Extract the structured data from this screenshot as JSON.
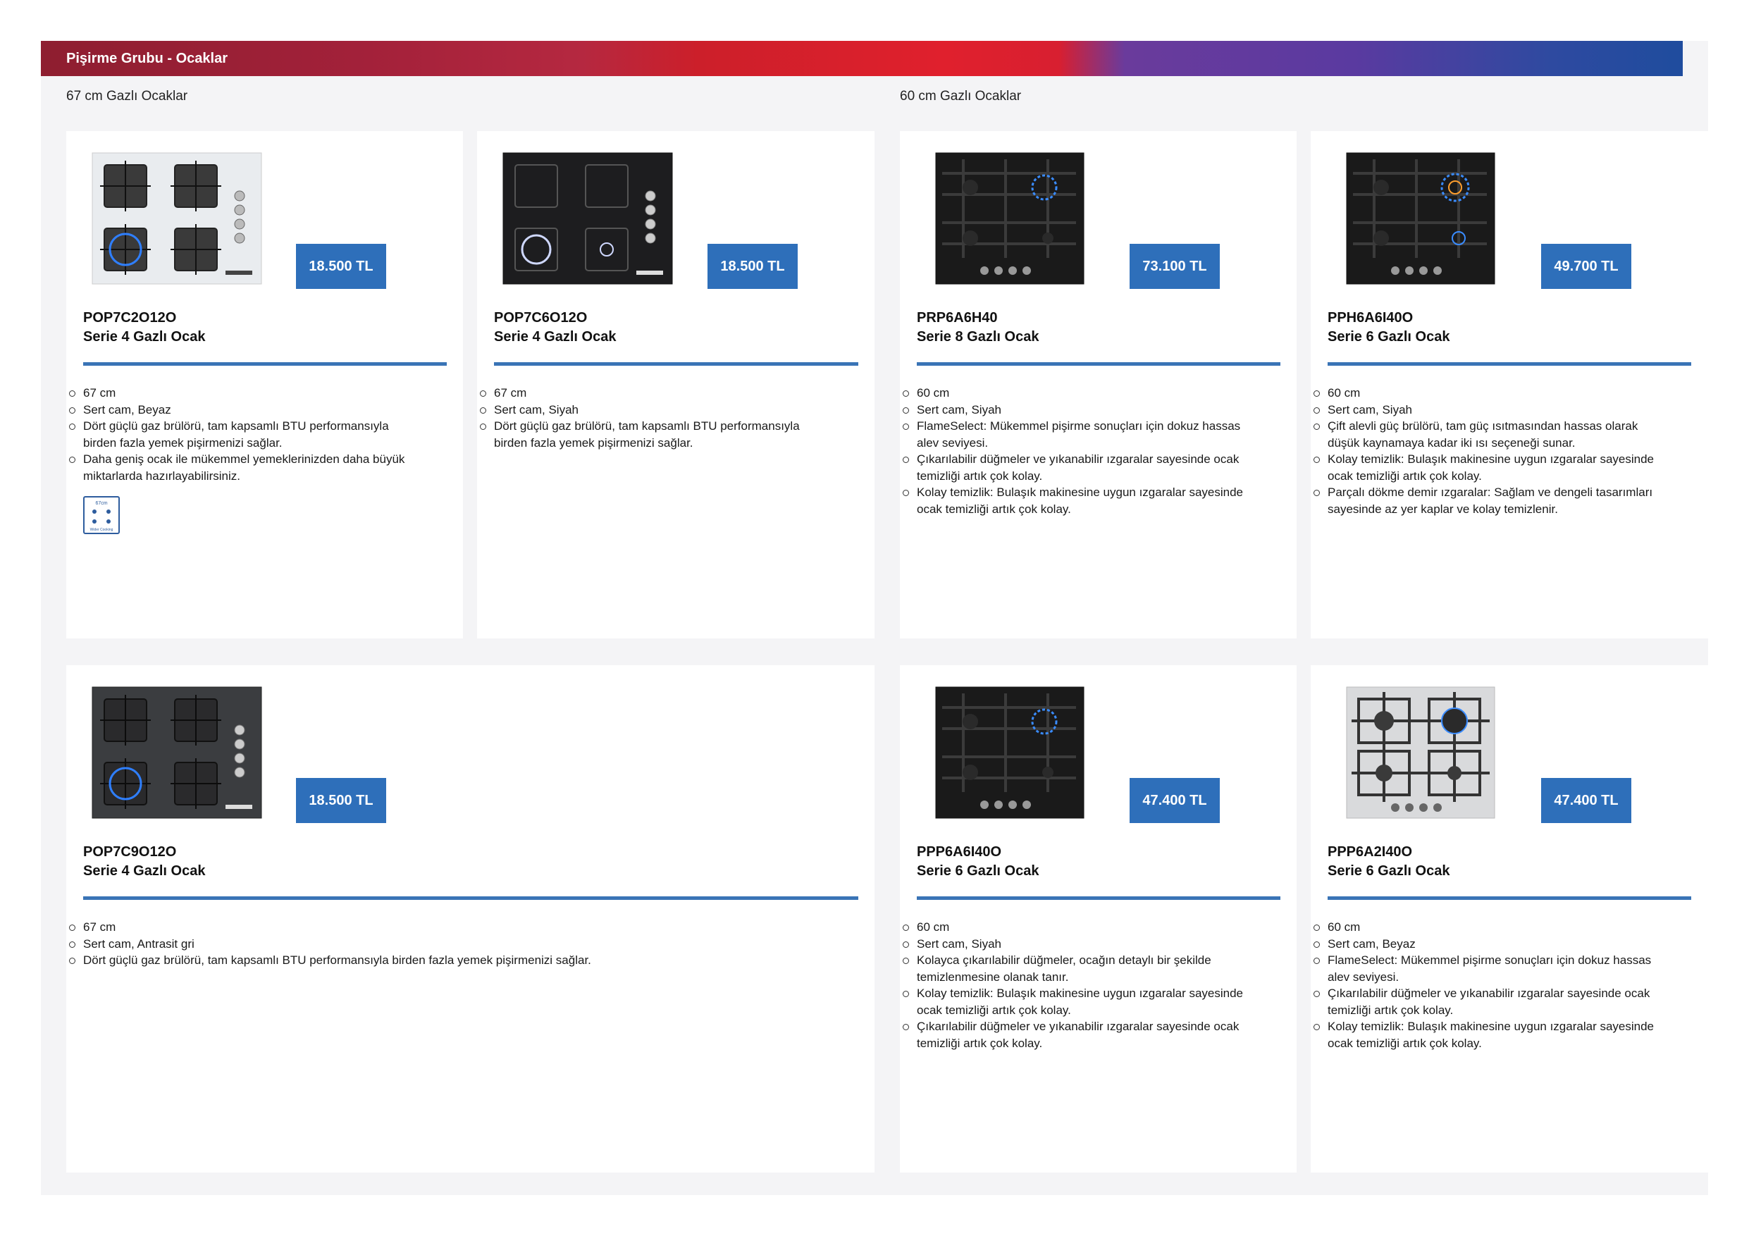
{
  "header": {
    "title": "Pişirme Grubu - Ocaklar"
  },
  "sections": [
    {
      "title": "67 cm Gazlı Ocaklar"
    },
    {
      "title": "60 cm Gazlı Ocaklar"
    }
  ],
  "products": [
    {
      "model": "POP7C2O12O",
      "series": "Serie 4 Gazlı Ocak",
      "price": "18.500 TL",
      "bullets": [
        "67 cm",
        "Sert cam, Beyaz",
        "Dört güçlü gaz brülörü, tam kapsamlı BTU performansıyla",
        "birden fazla yemek pişirmenizi sağlar.",
        "Daha geniş ocak ile mükemmel yemeklerinizden daha büyük",
        "miktarlarda hazırlayabilirsiniz."
      ],
      "badge": {
        "top": "67cm",
        "bottom": "Wider Cooking"
      }
    },
    {
      "model": "POP7C6O12O",
      "series": "Serie 4 Gazlı Ocak",
      "price": "18.500 TL",
      "bullets": [
        "67 cm",
        "Sert cam, Siyah",
        "Dört güçlü gaz brülörü, tam kapsamlı BTU performansıyla",
        "birden fazla yemek pişirmenizi sağlar."
      ]
    },
    {
      "model": "PRP6A6H40",
      "series": "Serie 8 Gazlı Ocak",
      "price": "73.100 TL",
      "bullets": [
        "60 cm",
        "Sert cam, Siyah",
        "FlameSelect: Mükemmel pişirme sonuçları için dokuz hassas",
        "alev seviyesi.",
        "Çıkarılabilir düğmeler ve yıkanabilir ızgaralar sayesinde ocak",
        "temizliği artık çok kolay.",
        "Kolay temizlik: Bulaşık makinesine uygun ızgaralar sayesinde",
        "ocak temizliği artık çok kolay."
      ]
    },
    {
      "model": "PPH6A6I40O",
      "series": "Serie 6 Gazlı Ocak",
      "price": "49.700 TL",
      "bullets": [
        "60 cm",
        "Sert cam, Siyah",
        "Çift alevli güç brülörü, tam güç ısıtmasından hassas olarak",
        "düşük kaynamaya kadar iki ısı seçeneği sunar.",
        "Kolay temizlik: Bulaşık makinesine uygun ızgaralar sayesinde",
        "ocak temizliği artık çok kolay.",
        "Parçalı dökme demir ızgaralar: Sağlam ve dengeli tasarımları",
        "sayesinde az yer kaplar ve kolay temizlenir."
      ]
    },
    {
      "model": "POP7C9O12O",
      "series": "Serie 4 Gazlı Ocak",
      "price": "18.500 TL",
      "bullets": [
        "67 cm",
        "Sert cam, Antrasit gri",
        "Dört güçlü gaz brülörü, tam kapsamlı BTU performansıyla birden fazla yemek pişirmenizi sağlar."
      ]
    },
    {
      "model": "PPP6A6I40O",
      "series": "Serie 6 Gazlı Ocak",
      "price": "47.400 TL",
      "bullets": [
        "60 cm",
        "Sert cam, Siyah",
        "Kolayca çıkarılabilir düğmeler, ocağın detaylı bir şekilde",
        "temizlenmesine olanak tanır.",
        "Kolay temizlik: Bulaşık makinesine uygun ızgaralar sayesinde",
        "ocak temizliği artık çok kolay.",
        "Çıkarılabilir düğmeler ve yıkanabilir ızgaralar sayesinde ocak",
        "temizliği artık çok kolay."
      ]
    },
    {
      "model": "PPP6A2I40O",
      "series": "Serie 6 Gazlı Ocak",
      "price": "47.400 TL",
      "bullets": [
        "60 cm",
        "Sert cam, Beyaz",
        "FlameSelect: Mükemmel pişirme sonuçları için dokuz hassas",
        "alev seviyesi.",
        "Çıkarılabilir düğmeler ve yıkanabilir ızgaralar sayesinde ocak",
        "temizliği artık çok kolay.",
        "Kolay temizlik: Bulaşık makinesine uygun ızgaralar sayesinde",
        "ocak temizliği artık çok kolay."
      ]
    }
  ]
}
